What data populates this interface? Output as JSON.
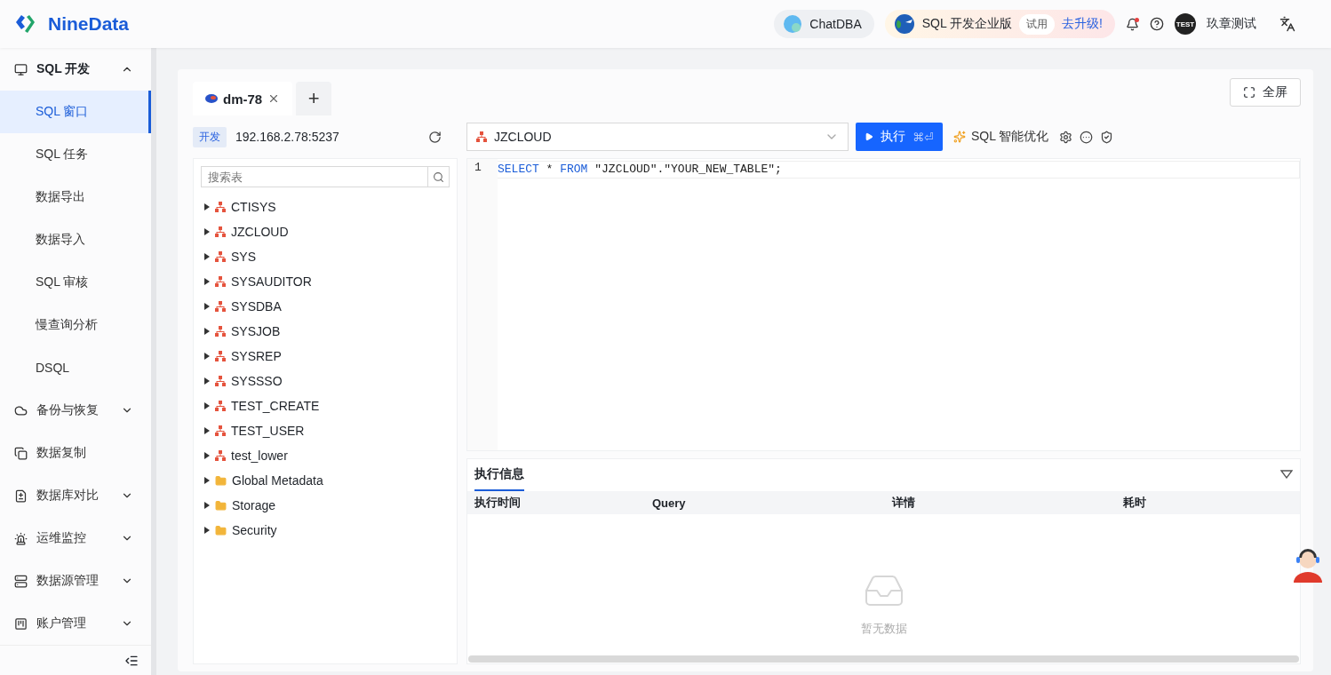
{
  "header": {
    "logo": "NineData",
    "chatdba": "ChatDBA",
    "edition": {
      "label": "SQL 开发企业版",
      "trial": "试用",
      "upgrade": "去升级!"
    },
    "notifications": {
      "unread": true
    },
    "user": {
      "avatar": "TEST",
      "name": "玖章测试"
    }
  },
  "sidebar": {
    "items": [
      {
        "label": "SQL 开发",
        "expandable": true,
        "expanded": true,
        "children": [
          {
            "label": "SQL 窗口",
            "selected": true
          },
          {
            "label": "SQL 任务",
            "selected": false
          },
          {
            "label": "数据导出",
            "selected": false
          },
          {
            "label": "数据导入",
            "selected": false
          },
          {
            "label": "SQL 审核",
            "selected": false
          },
          {
            "label": "慢查询分析",
            "selected": false
          },
          {
            "label": "DSQL",
            "selected": false
          }
        ]
      },
      {
        "label": "备份与恢复",
        "expandable": true,
        "expanded": false
      },
      {
        "label": "数据复制",
        "expandable": false,
        "expanded": false
      },
      {
        "label": "数据库对比",
        "expandable": true,
        "expanded": false
      },
      {
        "label": "运维监控",
        "expandable": true,
        "expanded": false
      },
      {
        "label": "数据源管理",
        "expandable": true,
        "expanded": false
      },
      {
        "label": "账户管理",
        "expandable": true,
        "expanded": false
      }
    ]
  },
  "fullscreen": "全屏",
  "tabs": [
    {
      "label": "dm-78",
      "selected": true
    }
  ],
  "add_tab": "+",
  "connection": {
    "env": "开发",
    "address": "192.168.2.78:5237"
  },
  "schema_select": {
    "value": "JZCLOUD"
  },
  "toolbar": {
    "run": "执行",
    "shortcut": "⌘⏎",
    "optimize": "SQL 智能优化"
  },
  "table_search": {
    "placeholder": "搜索表"
  },
  "tree": [
    {
      "label": "CTISYS",
      "kind": "schema",
      "expanded": false
    },
    {
      "label": "JZCLOUD",
      "kind": "schema",
      "expanded": false
    },
    {
      "label": "SYS",
      "kind": "schema",
      "expanded": false
    },
    {
      "label": "SYSAUDITOR",
      "kind": "schema",
      "expanded": false
    },
    {
      "label": "SYSDBA",
      "kind": "schema",
      "expanded": false
    },
    {
      "label": "SYSJOB",
      "kind": "schema",
      "expanded": false
    },
    {
      "label": "SYSREP",
      "kind": "schema",
      "expanded": false
    },
    {
      "label": "SYSSSO",
      "kind": "schema",
      "expanded": false
    },
    {
      "label": "TEST_CREATE",
      "kind": "schema",
      "expanded": false
    },
    {
      "label": "TEST_USER",
      "kind": "schema",
      "expanded": false
    },
    {
      "label": "test_lower",
      "kind": "schema",
      "expanded": false
    },
    {
      "label": "Global Metadata",
      "kind": "folder",
      "expanded": false
    },
    {
      "label": "Storage",
      "kind": "folder",
      "expanded": false
    },
    {
      "label": "Security",
      "kind": "folder",
      "expanded": false
    }
  ],
  "editor": {
    "lines": [
      {
        "number": "1",
        "tokens": [
          {
            "text": "SELECT",
            "kind": "keyword"
          },
          {
            "text": " * ",
            "kind": "plain"
          },
          {
            "text": "FROM",
            "kind": "keyword"
          },
          {
            "text": " \"JZCLOUD\".\"YOUR_NEW_TABLE\";",
            "kind": "plain"
          }
        ]
      }
    ]
  },
  "results": {
    "tabs": [
      {
        "label": "执行信息",
        "selected": true
      }
    ],
    "columns": [
      "执行时间",
      "Query",
      "详情",
      "耗时"
    ],
    "empty": "暂无数据"
  }
}
